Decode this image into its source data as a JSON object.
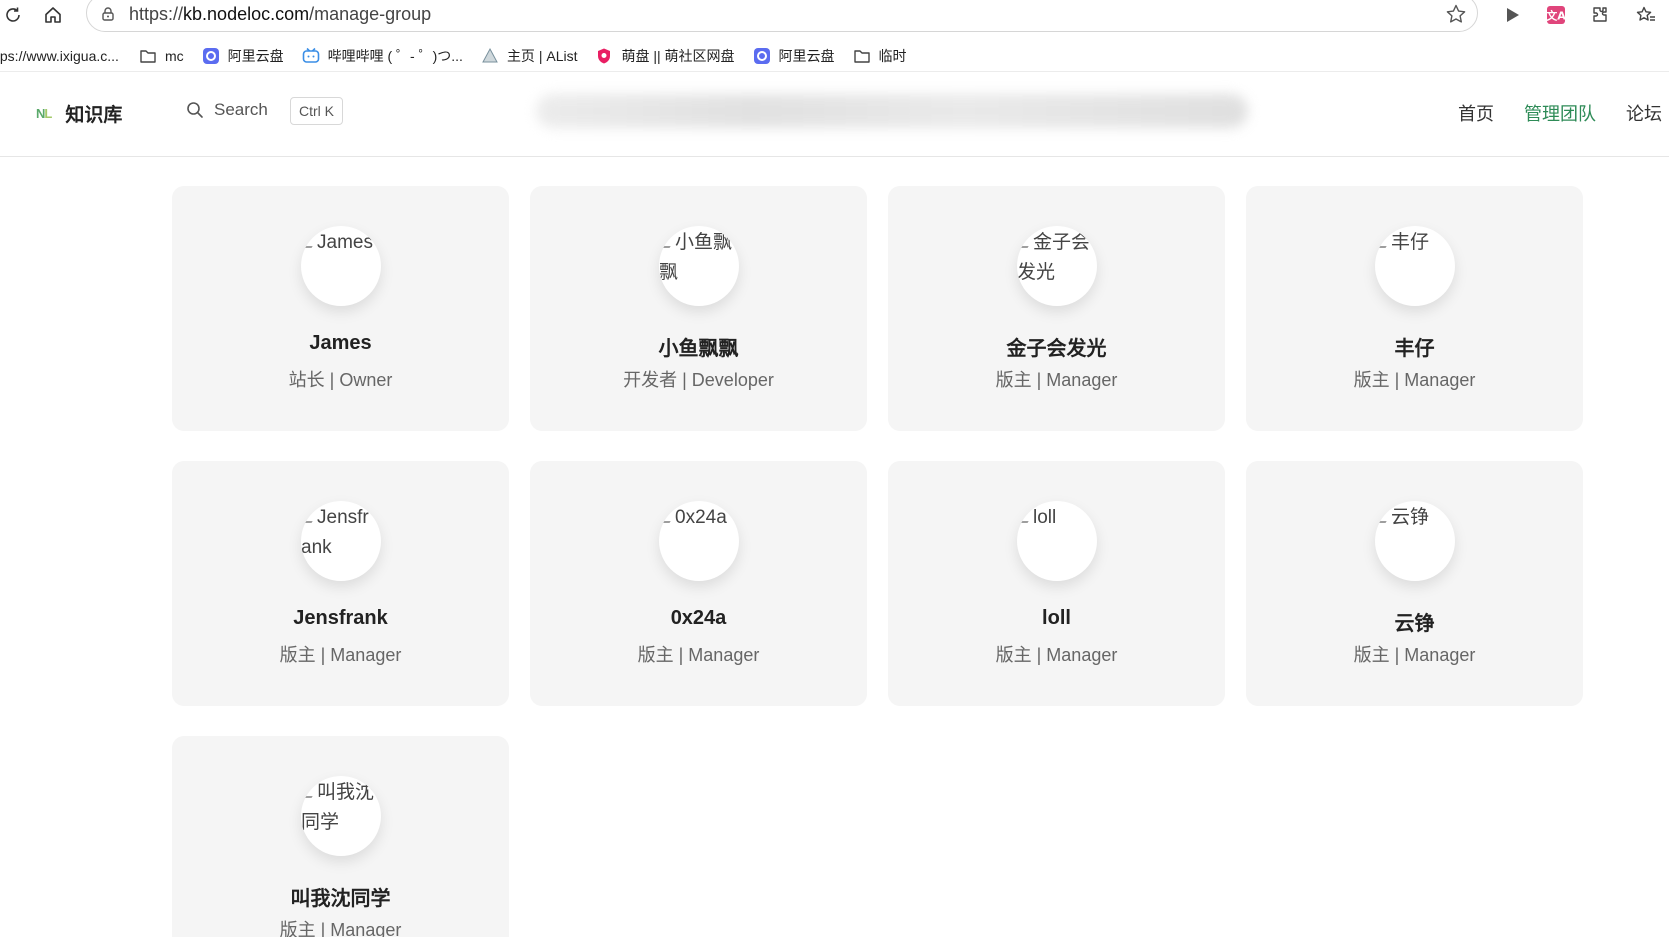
{
  "browser": {
    "url_scheme": "https://",
    "url_host": "kb.nodeloc.com",
    "url_path": "/manage-group"
  },
  "bookmarks": [
    {
      "label": "tps://www.ixigua.c...",
      "icon": "page-icon"
    },
    {
      "label": "mc",
      "icon": "folder-icon"
    },
    {
      "label": "阿里云盘",
      "icon": "aliyun-icon"
    },
    {
      "label": "哔哩哔哩 ( ゜- ゜)つ...",
      "icon": "bilibili-icon"
    },
    {
      "label": "主页 | AList",
      "icon": "alist-icon"
    },
    {
      "label": "萌盘 || 萌社区网盘",
      "icon": "moe-icon"
    },
    {
      "label": "阿里云盘",
      "icon": "aliyun-icon"
    },
    {
      "label": "临时",
      "icon": "folder-icon"
    }
  ],
  "header": {
    "logo_mark_n": "N",
    "logo_mark_l": "L",
    "logo_text": "知识库",
    "search_label": "Search",
    "search_shortcut": "Ctrl K",
    "nav": [
      {
        "label": "首页",
        "active": false
      },
      {
        "label": "管理团队",
        "active": true
      },
      {
        "label": "论坛",
        "active": false
      }
    ]
  },
  "colors": {
    "accent": "#2e8b57",
    "card_bg": "#f5f5f5"
  },
  "members": [
    {
      "avatar_alt": "James",
      "name": "James",
      "role": "站长 | Owner"
    },
    {
      "avatar_alt": "小鱼飘飘",
      "name": "小鱼飘飘",
      "role": "开发者 | Developer"
    },
    {
      "avatar_alt": "金子会发光",
      "name": "金子会发光",
      "role": "版主 | Manager"
    },
    {
      "avatar_alt": "丰仔",
      "name": "丰仔",
      "role": "版主 | Manager"
    },
    {
      "avatar_alt": "Jensfrank",
      "name": "Jensfrank",
      "role": "版主 | Manager"
    },
    {
      "avatar_alt": "0x24a",
      "name": "0x24a",
      "role": "版主 | Manager"
    },
    {
      "avatar_alt": "loll",
      "name": "loll",
      "role": "版主 | Manager"
    },
    {
      "avatar_alt": "云铮",
      "name": "云铮",
      "role": "版主 | Manager"
    },
    {
      "avatar_alt": "叫我沈同学",
      "name": "叫我沈同学",
      "role": "版主 | Manager"
    }
  ]
}
